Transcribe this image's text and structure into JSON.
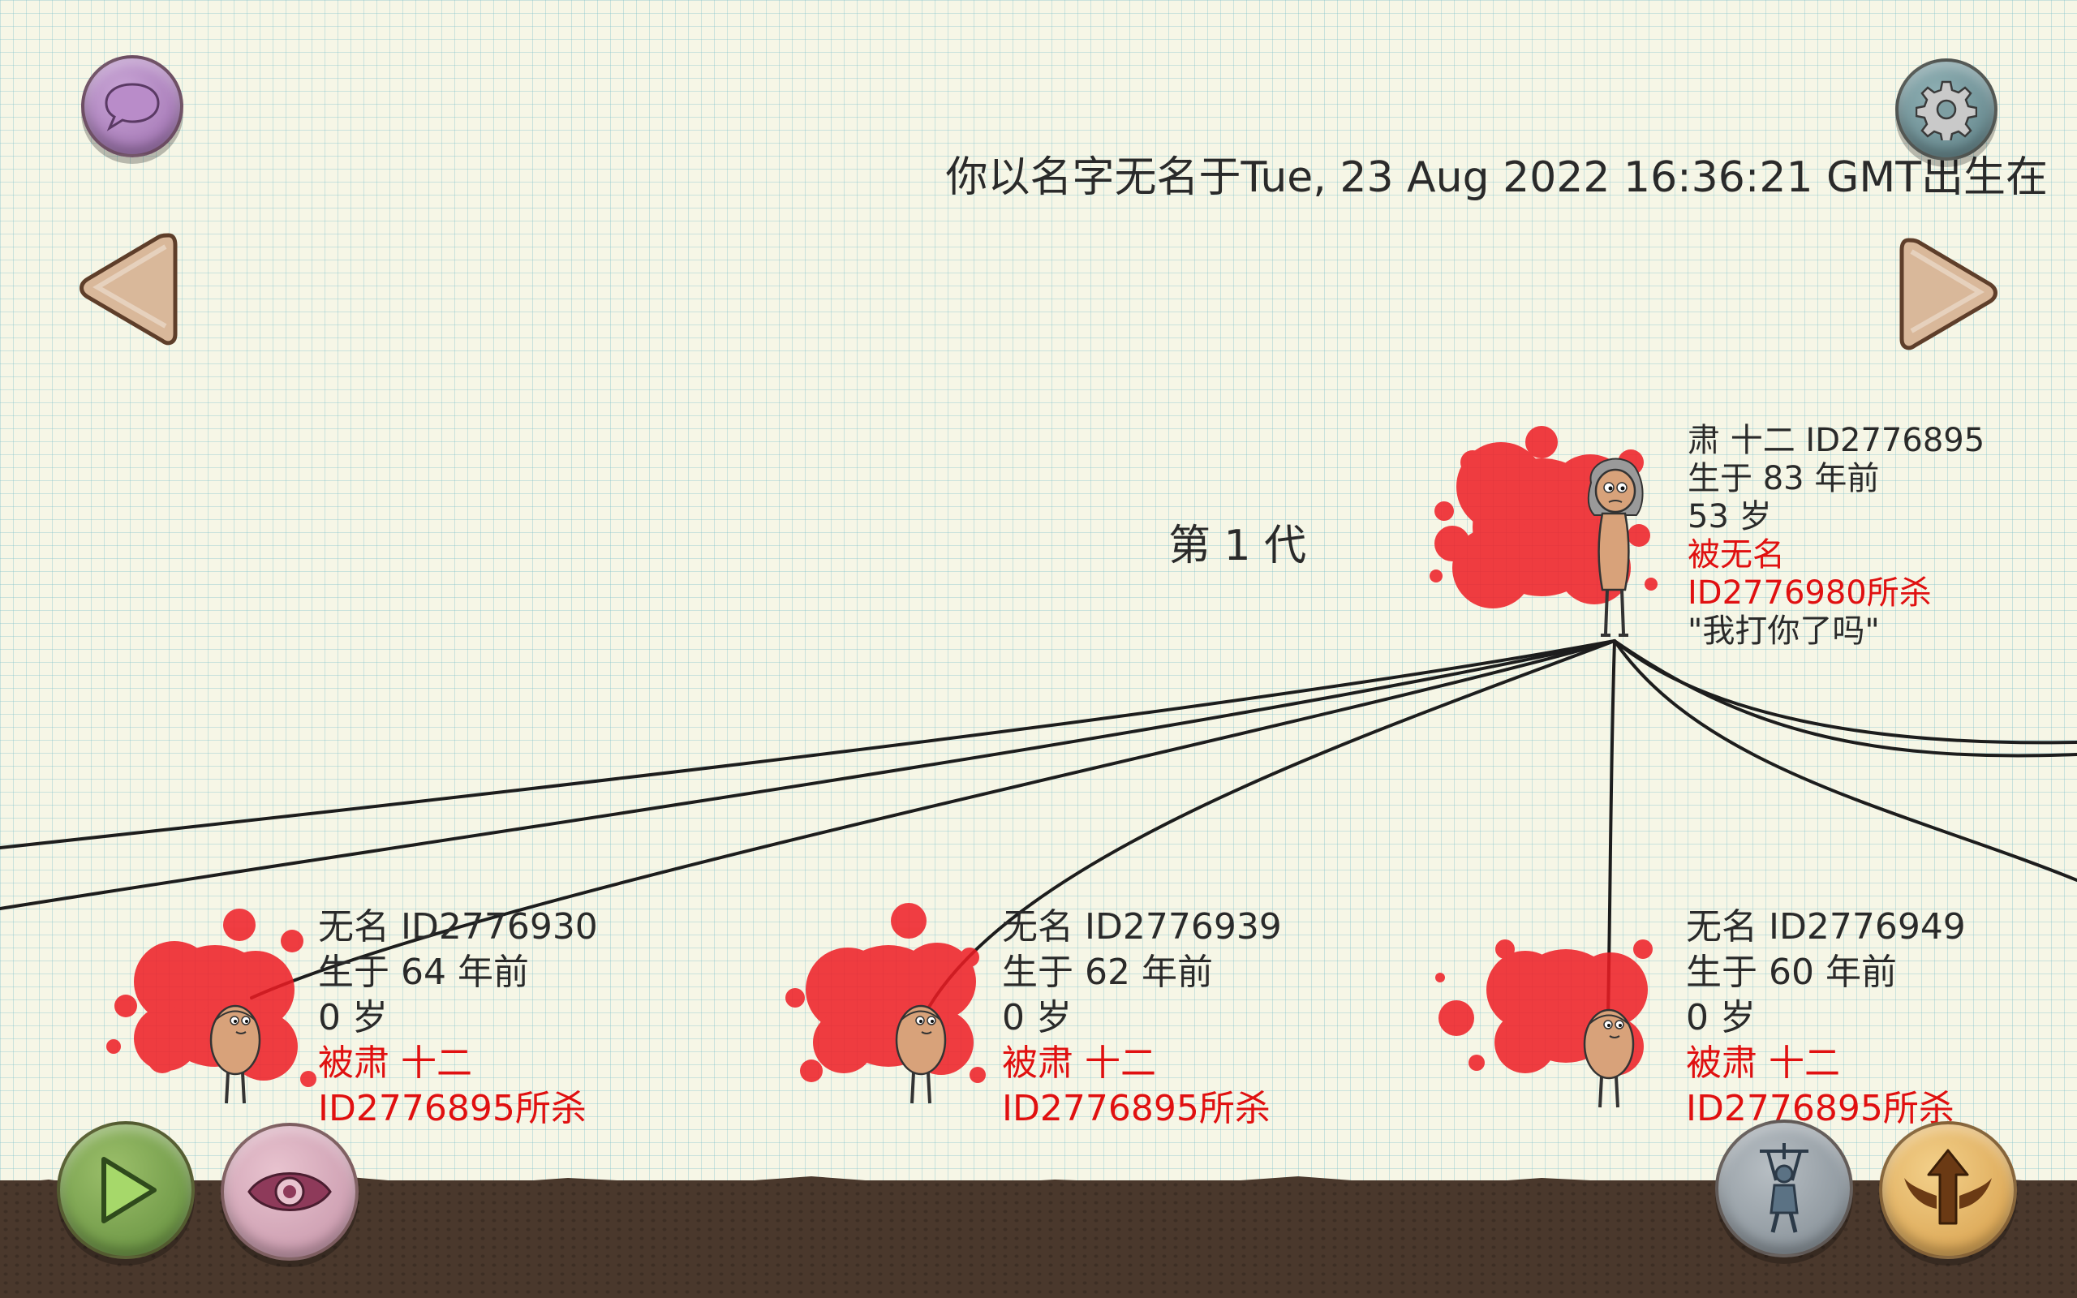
{
  "header": {
    "birth_text": "你以名字无名于Tue, 23 Aug 2022 16:36:21 GMT出生在"
  },
  "generation_label": "第 1 代",
  "parent": {
    "name_id": "肃 十二 ID2776895",
    "born": "生于 83 年前",
    "age": "53 岁",
    "killed_line1": "被无名",
    "killed_line2": "ID2776980所杀",
    "quote": "\"我打你了吗\""
  },
  "children": [
    {
      "name_id": "无名 ID2776930",
      "born": "生于 64 年前",
      "age": "0 岁",
      "killed_line1": "被肃 十二",
      "killed_line2": "ID2776895所杀"
    },
    {
      "name_id": "无名 ID2776939",
      "born": "生于 62 年前",
      "age": "0 岁",
      "killed_line1": "被肃 十二",
      "killed_line2": "ID2776895所杀"
    },
    {
      "name_id": "无名 ID2776949",
      "born": "生于 60 年前",
      "age": "0 岁",
      "killed_line1": "被肃 十二",
      "killed_line2": "ID2776895所杀"
    }
  ],
  "icons": {
    "chat": "chat-bubble-icon",
    "settings": "gear-icon",
    "prev": "arrow-left-icon",
    "next": "arrow-right-icon",
    "play": "play-icon",
    "watch": "eye-icon",
    "puppet": "puppet-icon",
    "ascend": "winged-arrow-up-icon"
  },
  "colors": {
    "paper": "#f6f6e6",
    "grid": "#78bec8",
    "blood": "#ee1c24",
    "killed_text": "#e01010",
    "ground": "#4a382c"
  }
}
